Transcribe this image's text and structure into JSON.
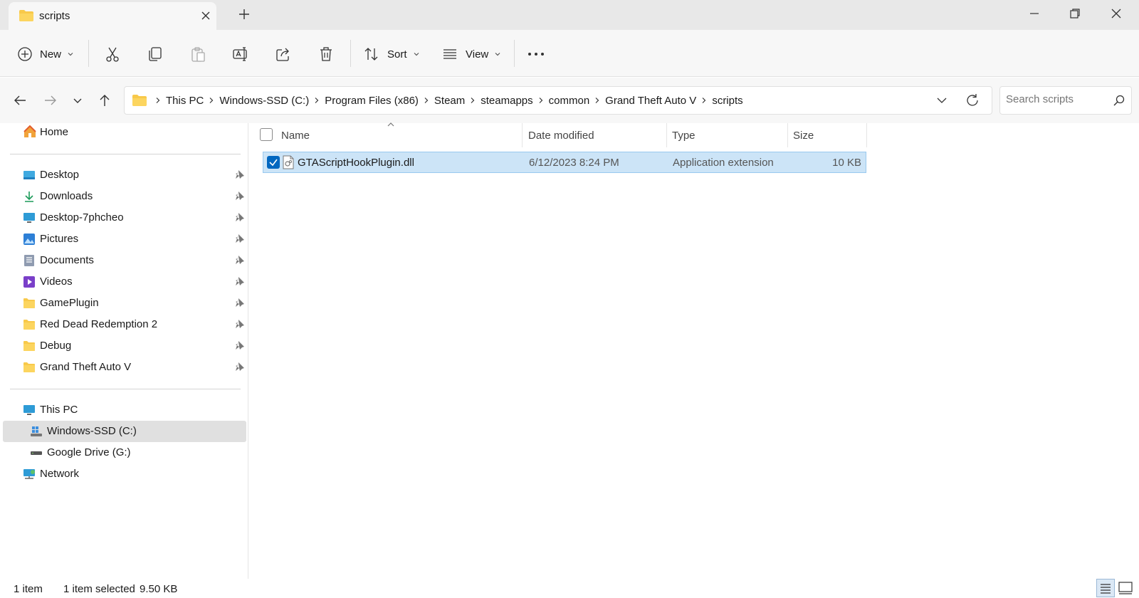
{
  "window": {
    "tab_title": "scripts",
    "colors": {
      "accent": "#0067c0",
      "folder": "#f8c94a",
      "selection": "#cce4f7"
    }
  },
  "commandbar": {
    "new_label": "New",
    "sort_label": "Sort",
    "view_label": "View",
    "icons": [
      "plus-circle-icon",
      "cut-icon",
      "copy-icon",
      "paste-icon",
      "rename-icon",
      "share-icon",
      "delete-icon",
      "sort-icon",
      "view-icon",
      "more-icon"
    ]
  },
  "address": {
    "crumbs": [
      "This PC",
      "Windows-SSD (C:)",
      "Program Files (x86)",
      "Steam",
      "steamapps",
      "common",
      "Grand Theft Auto V",
      "scripts"
    ]
  },
  "search": {
    "placeholder": "Search scripts"
  },
  "sidebar": {
    "home": "Home",
    "pinned": [
      {
        "label": "Desktop",
        "icon": "desktop-icon"
      },
      {
        "label": "Downloads",
        "icon": "download-icon"
      },
      {
        "label": "Desktop-7phcheo",
        "icon": "monitor-icon"
      },
      {
        "label": "Pictures",
        "icon": "pictures-icon"
      },
      {
        "label": "Documents",
        "icon": "documents-icon"
      },
      {
        "label": "Videos",
        "icon": "videos-icon"
      },
      {
        "label": "GamePlugin",
        "icon": "folder-icon"
      },
      {
        "label": "Red Dead Redemption 2",
        "icon": "folder-icon"
      },
      {
        "label": "Debug",
        "icon": "folder-icon"
      },
      {
        "label": "Grand Theft Auto V",
        "icon": "folder-icon"
      }
    ],
    "this_pc": "This PC",
    "drive_c": "Windows-SSD (C:)",
    "drive_g": "Google Drive (G:)",
    "network": "Network"
  },
  "filelist": {
    "columns": {
      "name": "Name",
      "date": "Date modified",
      "type": "Type",
      "size": "Size"
    },
    "rows": [
      {
        "name": "GTAScriptHookPlugin.dll",
        "date": "6/12/2023 8:24 PM",
        "type": "Application extension",
        "size": "10 KB"
      }
    ]
  },
  "status": {
    "item_count": "1 item",
    "selected": "1 item selected",
    "selected_size": "9.50 KB"
  }
}
